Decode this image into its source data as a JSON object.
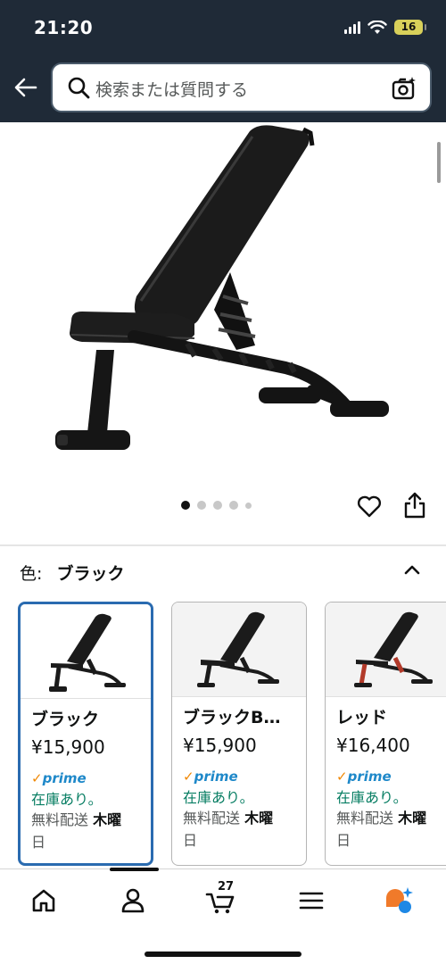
{
  "status_bar": {
    "time": "21:20",
    "battery": "16"
  },
  "header": {
    "search_placeholder": "検索または質問する"
  },
  "gallery": {
    "image_count": 5,
    "active_index": 0
  },
  "color_selector": {
    "label": "色:",
    "selected": "ブラック",
    "options": [
      {
        "name": "ブラック",
        "price": "¥15,900",
        "prime": "prime",
        "stock": "在庫あり。",
        "ship_prefix": "無料配送 ",
        "ship_day": "木曜",
        "ship_suffix": "日",
        "selected": true
      },
      {
        "name": "ブラックB…",
        "price": "¥15,900",
        "prime": "prime",
        "stock": "在庫あり。",
        "ship_prefix": "無料配送 ",
        "ship_day": "木曜",
        "ship_suffix": "日",
        "selected": false
      },
      {
        "name": "レッド",
        "price": "¥16,400",
        "prime": "prime",
        "stock": "在庫あり。",
        "ship_prefix": "無料配送 ",
        "ship_day": "木曜",
        "ship_suffix": "日",
        "selected": false
      }
    ]
  },
  "bottom_nav": {
    "cart_count": "27"
  },
  "colors": {
    "header_bg": "#1f2a37",
    "selected_border": "#2a6bb0",
    "stock_green": "#067d62",
    "prime_blue": "#1e88c9",
    "prime_check": "#f08804"
  }
}
